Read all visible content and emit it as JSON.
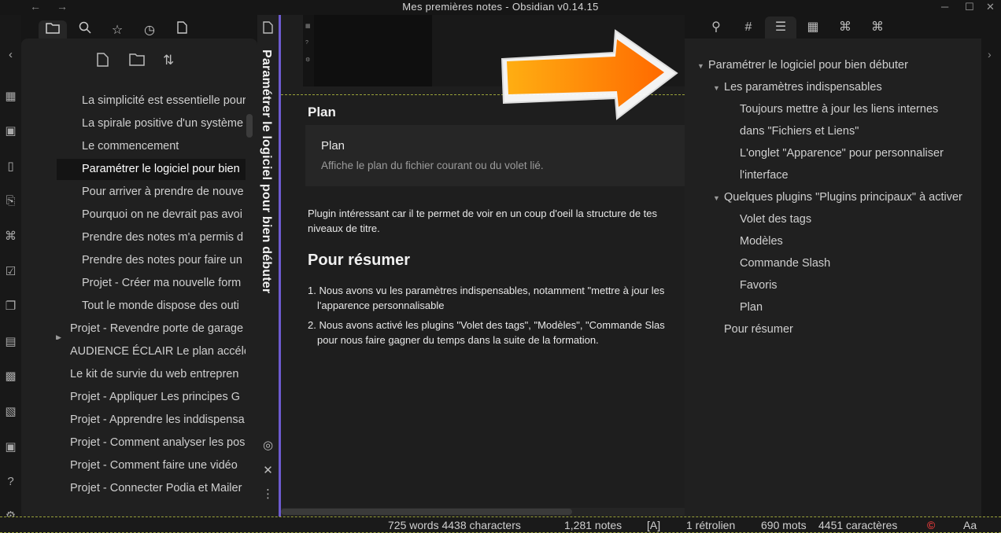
{
  "window": {
    "title": "Mes premières notes - Obsidian v0.14.15",
    "back_icon": "←",
    "forward_icon": "→",
    "minimize": "─",
    "maximize": "☐",
    "close": "✕"
  },
  "left_tabs": [
    "folder-icon",
    "search-icon",
    "star-icon",
    "clock-icon",
    "file-icon"
  ],
  "file_tree": [
    {
      "label": "La simplicité est essentielle pour",
      "indent": 2
    },
    {
      "label": "La spirale positive d'un système",
      "indent": 2
    },
    {
      "label": "Le commencement",
      "indent": 2
    },
    {
      "label": "Paramétrer le logiciel pour bien",
      "indent": 2,
      "active": true
    },
    {
      "label": "Pour arriver à prendre de nouve",
      "indent": 2
    },
    {
      "label": "Pourquoi on ne devrait pas avoi",
      "indent": 2
    },
    {
      "label": "Prendre des notes m'a permis d",
      "indent": 2
    },
    {
      "label": "Prendre des notes pour faire un",
      "indent": 2
    },
    {
      "label": "Projet - Créer ma nouvelle form",
      "indent": 2
    },
    {
      "label": "Tout le monde dispose des outi",
      "indent": 2
    },
    {
      "label": "Projet - Revendre porte de garage",
      "indent": 1,
      "folder": true
    },
    {
      "label": "AUDIENCE ÉCLAIR Le plan accélé",
      "indent": 1
    },
    {
      "label": "Le kit de survie du web entrepren",
      "indent": 1
    },
    {
      "label": "Projet - Appliquer Les principes G",
      "indent": 1
    },
    {
      "label": "Projet - Apprendre les inddispensa",
      "indent": 1
    },
    {
      "label": "Projet - Comment analyser les pos",
      "indent": 1
    },
    {
      "label": "Projet - Comment faire une vidéo",
      "indent": 1
    },
    {
      "label": "Projet - Connecter Podia et Mailer",
      "indent": 1
    }
  ],
  "stacked_header": {
    "title": "Paramétrer le logiciel pour bien débuter"
  },
  "note": {
    "heading_plan": "Plan",
    "plan_card_title": "Plan",
    "plan_card_desc": "Affiche le plan du fichier courant ou du volet lié.",
    "paragraph_line1": "Plugin intéressant car il te permet de voir en un coup d'oeil la structure de tes",
    "paragraph_line2": "niveaux de titre.",
    "heading_summary": "Pour résumer",
    "list": [
      {
        "num": "1.",
        "line1": "Nous avons vu les paramètres indispensables, notamment \"mettre à jour les",
        "line2": "l'apparence personnalisable"
      },
      {
        "num": "2.",
        "line1": "Nous avons activé les plugins \"Volet des tags\", \"Modèles\", \"Commande Slas",
        "line2": "pour nous faire gagner du temps dans la suite de la formation."
      }
    ]
  },
  "outline": [
    {
      "label": "Paramétrer le logiciel pour bien débuter",
      "level": 1,
      "caret": true
    },
    {
      "label": "Les paramètres indispensables",
      "level": 2,
      "caret": true
    },
    {
      "label": "Toujours mettre à jour les liens internes",
      "level": 3
    },
    {
      "label": "dans \"Fichiers et Liens\"",
      "level": 3
    },
    {
      "label": "L'onglet \"Apparence\" pour personnaliser",
      "level": 3
    },
    {
      "label": "l'interface",
      "level": 3
    },
    {
      "label": "Quelques plugins \"Plugins principaux\" à activer",
      "level": 2,
      "caret": true
    },
    {
      "label": "Volet des tags",
      "level": 3
    },
    {
      "label": "Modèles",
      "level": 3
    },
    {
      "label": "Commande Slash",
      "level": 3
    },
    {
      "label": "Favoris",
      "level": 3
    },
    {
      "label": "Plan",
      "level": 3
    },
    {
      "label": "Pour résumer",
      "level": 2
    }
  ],
  "status": {
    "words_chars": "725 words 4438 characters",
    "notes": "1,281 notes",
    "mode": "[A]",
    "backlinks": "1 rétrolien",
    "mots": "690 mots",
    "caracteres": "4451 caractères",
    "sync_icon": "©",
    "font": "Aa"
  },
  "colors": {
    "accent": "#6d5bd0",
    "arrow_orange": "#ff8a00"
  }
}
